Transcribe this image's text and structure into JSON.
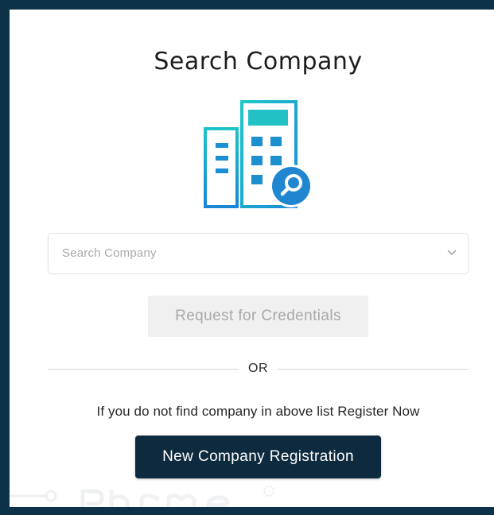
{
  "modal": {
    "title": "Search Company"
  },
  "illustration": {
    "icon": "building-search-icon",
    "colors": {
      "primary": "#1aa6c9",
      "accent": "#1f7ec2"
    }
  },
  "search": {
    "placeholder": "Search Company",
    "selected_value": ""
  },
  "credentials_button": {
    "label": "Request for Credentials"
  },
  "divider": {
    "label": "OR"
  },
  "hint": {
    "text": "If you do not find company in above list Register Now"
  },
  "register_button": {
    "label": "New Company Registration"
  },
  "colors": {
    "background": "#0d3146",
    "primary_button": "#0e2a3f",
    "disabled_button": "#f0f0f0"
  }
}
